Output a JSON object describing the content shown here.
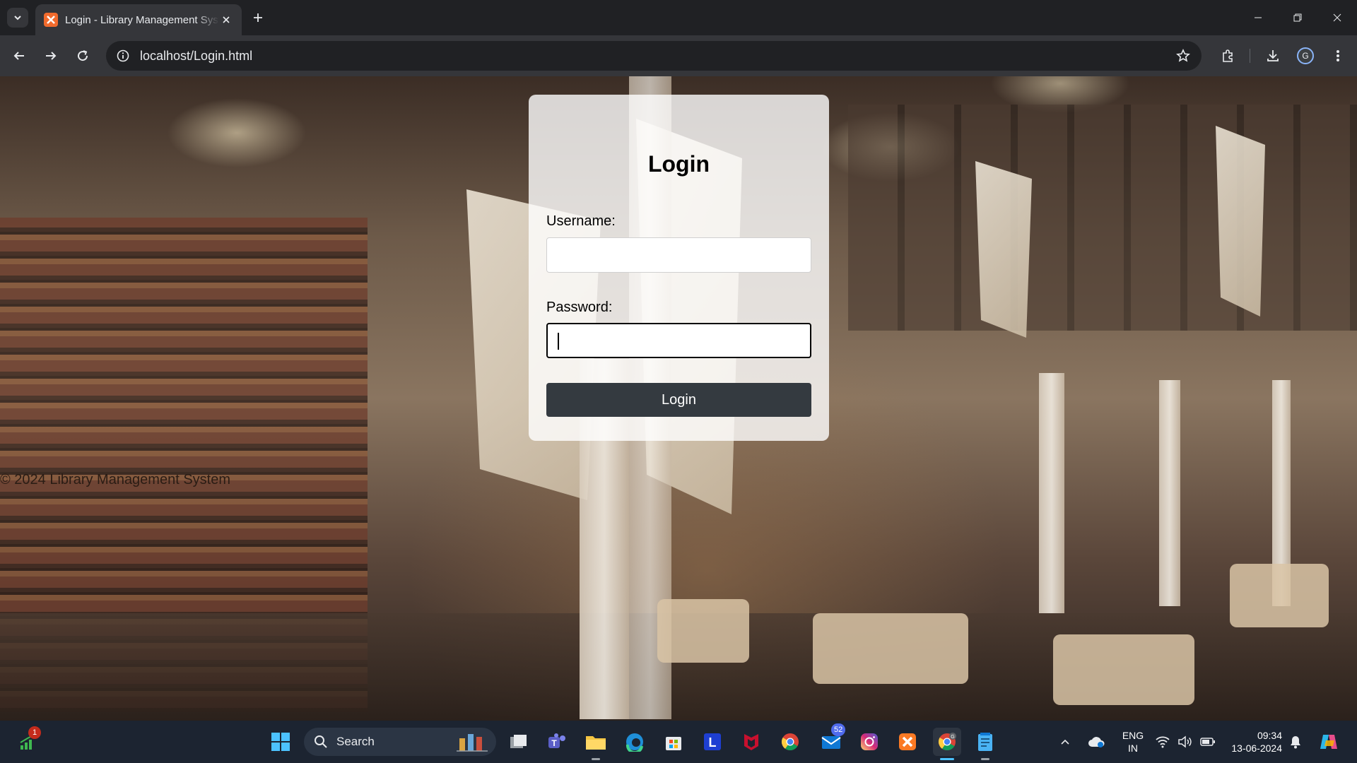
{
  "browser": {
    "tab_title": "Login - Library Management System",
    "url": "localhost/Login.html",
    "profile_initial": "G"
  },
  "page": {
    "heading": "Login",
    "username_label": "Username:",
    "username_value": "",
    "password_label": "Password:",
    "password_value": "",
    "login_button": "Login",
    "footer": "© 2024 Library Management System",
    "background_image": "library interior with ship sails and bookshelves"
  },
  "taskbar": {
    "search_label": "Search",
    "widgets_badge": "1",
    "outlook_badge": "52",
    "lang_line1": "ENG",
    "lang_line2": "IN",
    "time": "09:34",
    "date": "13-06-2024"
  },
  "colors": {
    "login_button_bg": "#343a40",
    "card_bg": "rgba(255,255,255,0.8)",
    "chrome_dark": "#202124",
    "accent": "#4cc2ff"
  }
}
